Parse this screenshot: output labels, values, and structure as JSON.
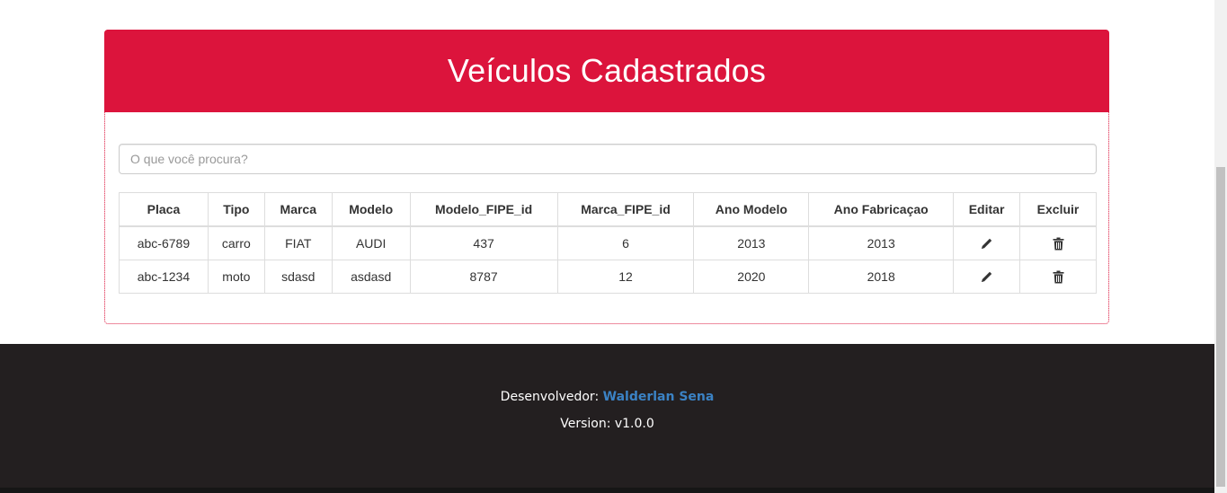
{
  "panel": {
    "title": "Veículos Cadastrados"
  },
  "search": {
    "placeholder": "O que você procura?",
    "value": ""
  },
  "table": {
    "headers": [
      "Placa",
      "Tipo",
      "Marca",
      "Modelo",
      "Modelo_FIPE_id",
      "Marca_FIPE_id",
      "Ano Modelo",
      "Ano Fabricaçao",
      "Editar",
      "Excluir"
    ],
    "rows": [
      {
        "placa": "abc-6789",
        "tipo": "carro",
        "marca": "FIAT",
        "modelo": "AUDI",
        "modelo_fipe_id": "437",
        "marca_fipe_id": "6",
        "ano_modelo": "2013",
        "ano_fabricacao": "2013",
        "edit_icon": "pencil-icon",
        "delete_icon": "trash-icon"
      },
      {
        "placa": "abc-1234",
        "tipo": "moto",
        "marca": "sdasd",
        "modelo": "asdasd",
        "modelo_fipe_id": "8787",
        "marca_fipe_id": "12",
        "ano_modelo": "2020",
        "ano_fabricacao": "2018",
        "edit_icon": "pencil-icon",
        "delete_icon": "trash-icon"
      }
    ]
  },
  "footer": {
    "developer_label": "Desenvolvedor:",
    "developer_name": "Walderlan Sena",
    "version": "Version: v1.0.0"
  },
  "colors": {
    "accent": "#dc143c",
    "footer_bg": "#231f20",
    "link": "#3b82c4"
  }
}
